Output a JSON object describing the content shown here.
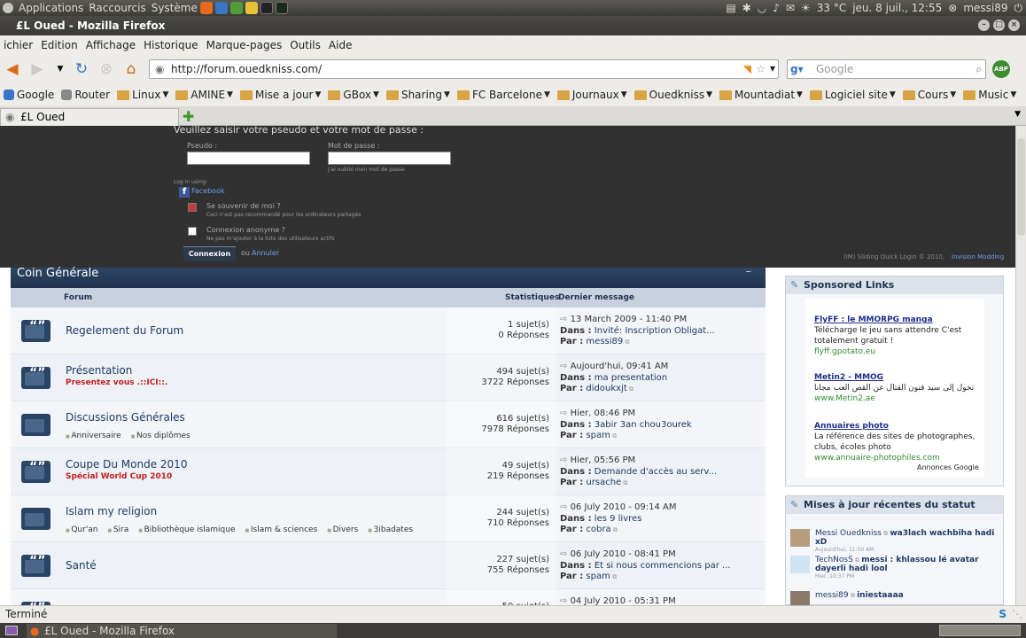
{
  "top_panel": {
    "apps": "Applications",
    "places": "Raccourcis",
    "system": "Système",
    "weather": "33 °C",
    "datetime": "jeu. 8 juil., 12:55",
    "user": "messi89"
  },
  "window": {
    "title": "£L Oued - Mozilla Firefox"
  },
  "menu": [
    "ichier",
    "Edition",
    "Affichage",
    "Historique",
    "Marque-pages",
    "Outils",
    "Aide"
  ],
  "url": "http://forum.ouedkniss.com/",
  "search_placeholder": "Google",
  "abp": "ABP",
  "bookmarks": [
    {
      "label": "Google",
      "folder": false
    },
    {
      "label": "Router",
      "folder": false
    },
    {
      "label": "Linux",
      "folder": true
    },
    {
      "label": "AMINE",
      "folder": true
    },
    {
      "label": "Mise a jour",
      "folder": true
    },
    {
      "label": "GBox",
      "folder": true
    },
    {
      "label": "Sharing",
      "folder": true
    },
    {
      "label": "FC Barcelone",
      "folder": true
    },
    {
      "label": "Journaux",
      "folder": true
    },
    {
      "label": "Ouedkniss",
      "folder": true
    },
    {
      "label": "Mountadiat",
      "folder": true
    },
    {
      "label": "Logiciel site",
      "folder": true
    },
    {
      "label": "Cours",
      "folder": true
    },
    {
      "label": "Music",
      "folder": true
    }
  ],
  "tab": {
    "title": "£L Oued"
  },
  "login": {
    "prompt": "Veuillez saisir votre pseudo et votre mot de passe :",
    "user_label": "Pseudo :",
    "pass_label": "Mot de passe :",
    "forgot": "J'ai oublié mon mot de passe",
    "log_in_using": "Log in using:",
    "facebook": "Facebook",
    "remember": "Se souvenir de moi ?",
    "remember_note": "Ceci n'est pas recommandé pour les ordinateurs partagés",
    "anon": "Connexion anonyme ?",
    "anon_note": "Ne pas m'ajouter à la liste des utilisateurs actifs",
    "button": "Connexion",
    "or": "ou",
    "cancel": "Annuler",
    "credit": "(IM) Sliding Quick Login © 2010,",
    "credit_link": "Invision Modding"
  },
  "category": {
    "title": "Coin Générale",
    "col_forum": "Forum",
    "col_stats": "Statistiques",
    "col_last": "Dernier message"
  },
  "forums": [
    {
      "name": "Regelement du Forum",
      "desc": "",
      "subs": [],
      "topics": "1 sujet(s)",
      "replies": "0 Réponses",
      "date": "13 March 2009 - 11:40 PM",
      "in": "Invité: Inscription Obligat...",
      "by": "messi89"
    },
    {
      "name": "Présentation",
      "desc": "Presentez vous  .::ICI::.",
      "subs": [],
      "topics": "494 sujet(s)",
      "replies": "3722 Réponses",
      "date": "Aujourd'hui, 09:41 AM",
      "in": "ma presentation",
      "by": "didoukxjt"
    },
    {
      "name": "Discussions Générales",
      "desc": "",
      "subs": [
        "Anniversaire",
        "Nos diplômes"
      ],
      "topics": "616 sujet(s)",
      "replies": "7978 Réponses",
      "date": "Hier, 08:46 PM",
      "in": "3abir 3an chou3ourek",
      "by": "spam"
    },
    {
      "name": "Coupe Du Monde 2010",
      "desc": "Spécial World Cup 2010",
      "subs": [],
      "topics": "49 sujet(s)",
      "replies": "219 Réponses",
      "date": "Hier, 05:56 PM",
      "in": "Demande d'accès au serv...",
      "by": "ursache"
    },
    {
      "name": "Islam my religion",
      "desc": "",
      "subs": [
        "Qur'an",
        "Sira",
        "Bibliothèque islamique",
        "Islam & sciences",
        "Divers",
        "3ibadates"
      ],
      "topics": "244 sujet(s)",
      "replies": "710 Réponses",
      "date": "06 July 2010 - 09:14 AM",
      "in": "les 9 livres",
      "by": "cobra"
    },
    {
      "name": "Santé",
      "desc": "",
      "subs": [],
      "topics": "227 sujet(s)",
      "replies": "755 Réponses",
      "date": "06 July 2010 - 08:41 PM",
      "in": "Et si nous commencions par ...",
      "by": "spam"
    },
    {
      "name": "",
      "desc": "",
      "subs": [],
      "topics": "50 sujet(s)",
      "replies": "",
      "date": "04 July 2010 - 05:31 PM",
      "in": "",
      "by": ""
    }
  ],
  "labels": {
    "dans": "Dans :",
    "par": "Par :"
  },
  "sponsored": {
    "title": "Sponsored Links",
    "ads": [
      {
        "title": "FlyFF : le MMORPG manga",
        "text": "Télécharge le jeu sans attendre C'est totalement gratuit !",
        "url": "flyff.gpotato.eu"
      },
      {
        "title": "Metin2 - MMOG",
        "text": "تحول إلى سيد فنون القتال عن القص العب مجانا",
        "url": "www.Metin2.ae"
      },
      {
        "title": "Annuaires photo",
        "text": "La référence des sites de photographes, clubs, écoles photo",
        "url": "www.annuaire-photophiles.com"
      }
    ],
    "annonces": "Annonces Google"
  },
  "status_updates": {
    "title": "Mises à jour récentes du statut",
    "items": [
      {
        "name": "Messi Ouedkniss",
        "text": "wa3lach wachbiha hadi xD",
        "time": "Aujourd'hui, 11:50 AM"
      },
      {
        "name": "TechNosS",
        "text": "messi : khlassou lé avatar dayerli hadi lool",
        "time": "Hier, 10:37 PM"
      },
      {
        "name": "messi89",
        "text": "iniestaaaa",
        "time": ""
      }
    ]
  },
  "statusbar": "Terminé",
  "taskbar": {
    "item": "£L Oued - Mozilla Firefox"
  }
}
